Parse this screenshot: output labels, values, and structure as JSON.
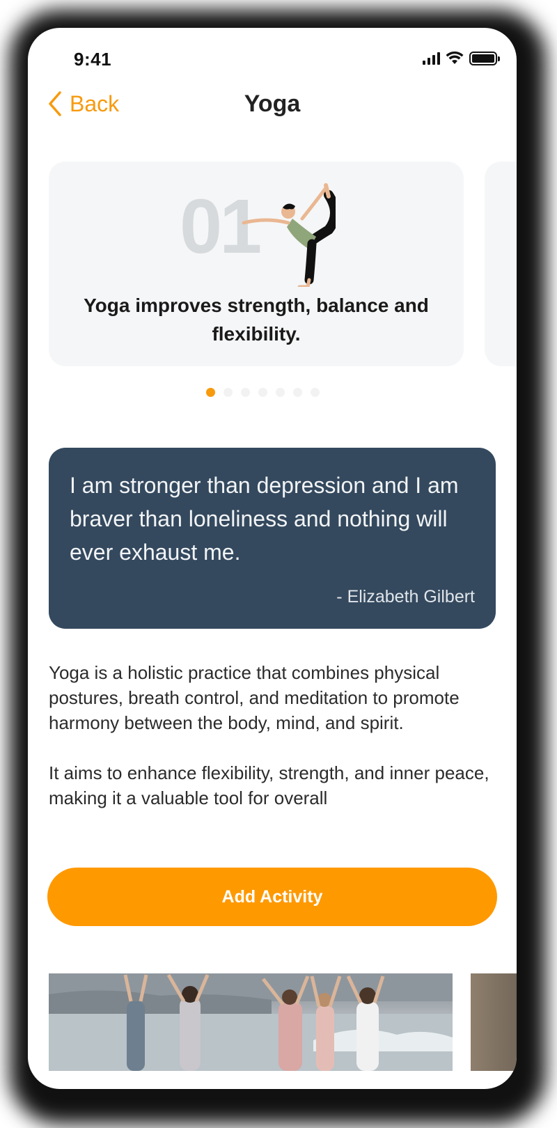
{
  "status_bar": {
    "time": "9:41"
  },
  "nav": {
    "back_label": "Back",
    "title": "Yoga"
  },
  "carousel": {
    "number": "01",
    "text": "Yoga improves strength, balance and flexibility.",
    "total_pages": 7,
    "active_page": 1
  },
  "quote": {
    "text": "I am stronger than depression and I am braver than loneliness and nothing will ever exhaust me.",
    "author": "- Elizabeth Gilbert"
  },
  "description": {
    "paragraph_1": "Yoga is a holistic practice that combines physical postures, breath control, and meditation to promote harmony between the body, mind, and spirit.",
    "paragraph_2": "It aims to enhance flexibility, strength, and inner peace, making it a valuable tool for overall"
  },
  "button": {
    "label": "Add Activity"
  },
  "colors": {
    "accent": "#FF9900",
    "back_link": "#F79A0E",
    "quote_bg": "#34495E",
    "card_bg": "#F5F6F7"
  }
}
